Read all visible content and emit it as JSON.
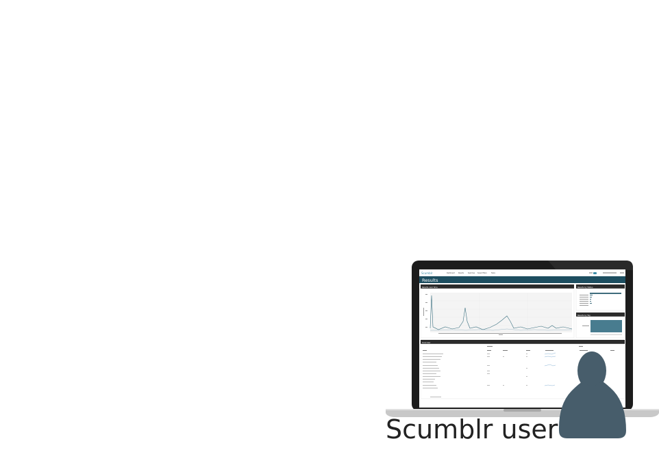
{
  "caption": "Scumblr user",
  "screen": {
    "logo": "Scumblr",
    "nav_items": [
      "Dashboard",
      "Results",
      "Searches",
      "Saved filters",
      "Tasks"
    ],
    "page_title": "Results",
    "panels": {
      "over_time": "Results over time",
      "by_status": "Results by Status",
      "by_tag": "Results by Tag",
      "overview": "Overview"
    }
  },
  "colors": {
    "header_bar": "#1d4e60",
    "accent_bar": "#3e6c7c",
    "user_silhouette": "#475d6b",
    "laptop_bezel": "#1c1c1c",
    "laptop_base": "#c8c8c8"
  },
  "icons": [
    "user-silhouette-icon",
    "laptop-icon"
  ]
}
